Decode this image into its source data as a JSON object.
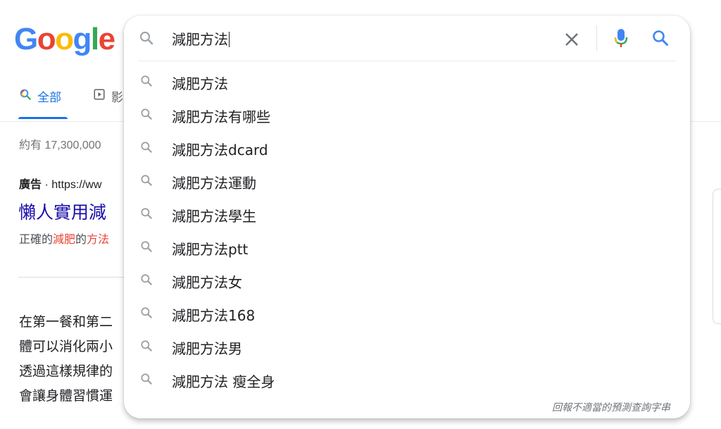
{
  "logo": {
    "letters": [
      "G",
      "o",
      "o",
      "g",
      "l",
      "e"
    ],
    "colors": [
      "#4285f4",
      "#ea4335",
      "#fbbc05",
      "#4285f4",
      "#34a853",
      "#ea4335"
    ]
  },
  "tabs": [
    {
      "label": "全部",
      "icon": "search-icon",
      "active": true
    },
    {
      "label": "影",
      "icon": "play-icon",
      "active": false
    }
  ],
  "results": {
    "stats": "約有 17,300,000",
    "ad": {
      "badge": "廣告",
      "separator": " · ",
      "url": "https://ww",
      "title": "懶人實用減",
      "desc_before": "正確的",
      "desc_highlight1": "減肥",
      "desc_middle": "的",
      "desc_highlight2": "方法"
    },
    "snippet_lines": [
      "在第一餐和第二",
      "體可以消化兩小",
      "透過這樣規律的",
      "會讓身體習慣運"
    ]
  },
  "search": {
    "query": "減肥方法",
    "clear_icon": "close-icon",
    "voice_icon": "mic-icon",
    "submit_icon": "search-icon",
    "suggestions": [
      "減肥方法",
      "減肥方法有哪些",
      "減肥方法dcard",
      "減肥方法運動",
      "減肥方法學生",
      "減肥方法ptt",
      "減肥方法女",
      "減肥方法168",
      "減肥方法男",
      "減肥方法 瘦全身"
    ],
    "report_link": "回報不適當的預測查詢字串"
  },
  "colors": {
    "link": "#1a0dab",
    "accent": "#1a73e8",
    "highlight": "#ea4335",
    "icon_gray": "#70757a"
  }
}
